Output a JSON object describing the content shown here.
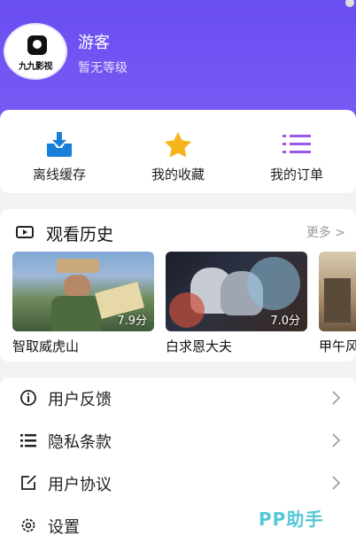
{
  "profile": {
    "name": "游客",
    "level": "暂无等级",
    "logo_text": "九九影视"
  },
  "quick_actions": [
    {
      "label": "离线缓存",
      "icon": "download-tray-icon"
    },
    {
      "label": "我的收藏",
      "icon": "star-icon"
    },
    {
      "label": "我的订单",
      "icon": "list-icon"
    }
  ],
  "history": {
    "title": "观看历史",
    "more": "更多 >",
    "items": [
      {
        "title": "智取威虎山",
        "rating": "7.9分"
      },
      {
        "title": "白求恩大夫",
        "rating": "7.0分"
      },
      {
        "title": "甲午风",
        "rating": ""
      }
    ]
  },
  "menu": [
    {
      "label": "用户反馈",
      "icon": "info-circle-icon"
    },
    {
      "label": "隐私条款",
      "icon": "bullet-list-icon"
    },
    {
      "label": "用户协议",
      "icon": "edit-square-icon"
    },
    {
      "label": "设置",
      "icon": "gear-icon"
    }
  ],
  "watermark": "PP助手",
  "colors": {
    "header": "#6a4df0",
    "accent_blue": "#1a7fd8",
    "star": "#f6b31b",
    "list_purple": "#9a57e8"
  }
}
